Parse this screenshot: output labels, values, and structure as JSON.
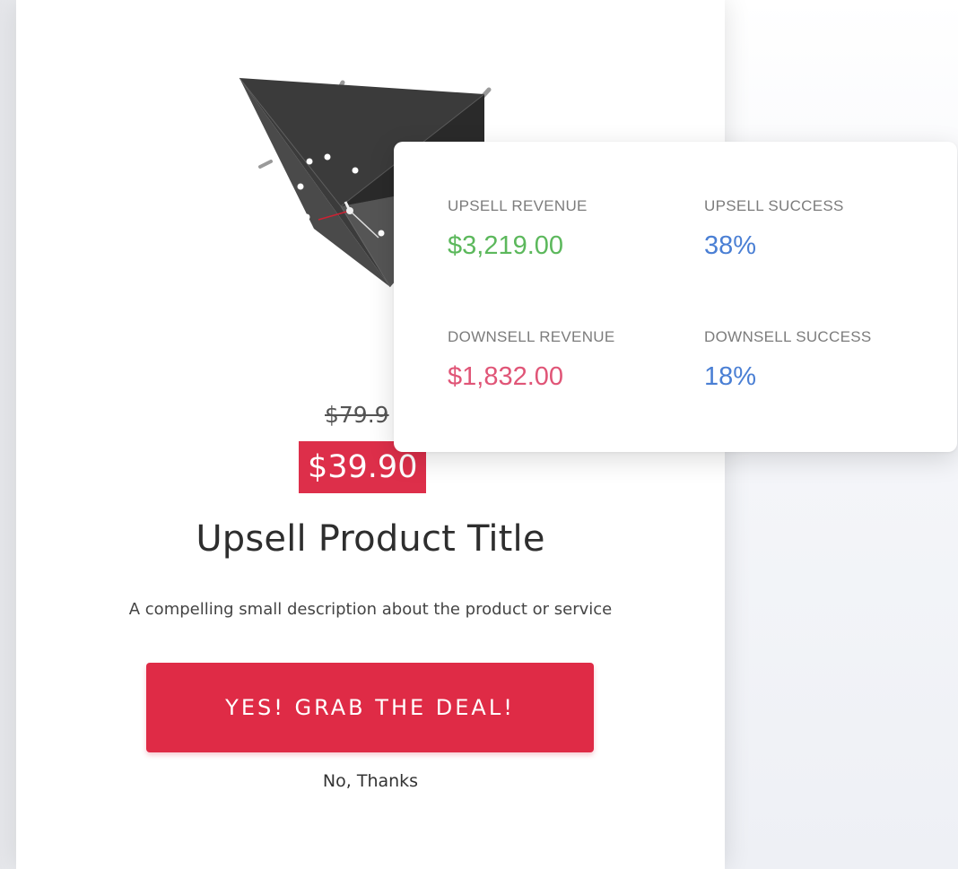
{
  "product": {
    "old_price": "$79.9",
    "new_price": "$39.90",
    "title": "Upsell Product Title",
    "description": "A compelling small description about the product or service",
    "image_icon": "pyramid-clock-product-image"
  },
  "actions": {
    "cta_label": "YES! GRAB THE DEAL!",
    "decline_label": "No, Thanks"
  },
  "stats": [
    {
      "label": "UPSELL REVENUE",
      "value": "$3,219.00",
      "color": "#5cb85c"
    },
    {
      "label": "UPSELL SUCCESS",
      "value": "38%",
      "color": "#4a7fd4"
    },
    {
      "label": "DOWNSELL REVENUE",
      "value": "$1,832.00",
      "color": "#e05577"
    },
    {
      "label": "DOWNSELL SUCCESS",
      "value": "18%",
      "color": "#4a7fd4"
    }
  ],
  "colors": {
    "accent": "#df2b46",
    "price_badge": "#dd2f4a"
  }
}
